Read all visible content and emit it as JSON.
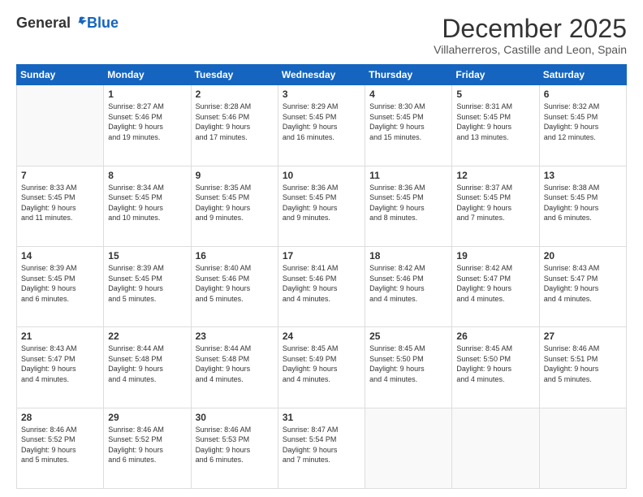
{
  "logo": {
    "general": "General",
    "blue": "Blue"
  },
  "header": {
    "month": "December 2025",
    "location": "Villaherreros, Castille and Leon, Spain"
  },
  "weekdays": [
    "Sunday",
    "Monday",
    "Tuesday",
    "Wednesday",
    "Thursday",
    "Friday",
    "Saturday"
  ],
  "weeks": [
    [
      {
        "day": "",
        "info": ""
      },
      {
        "day": "1",
        "info": "Sunrise: 8:27 AM\nSunset: 5:46 PM\nDaylight: 9 hours\nand 19 minutes."
      },
      {
        "day": "2",
        "info": "Sunrise: 8:28 AM\nSunset: 5:46 PM\nDaylight: 9 hours\nand 17 minutes."
      },
      {
        "day": "3",
        "info": "Sunrise: 8:29 AM\nSunset: 5:45 PM\nDaylight: 9 hours\nand 16 minutes."
      },
      {
        "day": "4",
        "info": "Sunrise: 8:30 AM\nSunset: 5:45 PM\nDaylight: 9 hours\nand 15 minutes."
      },
      {
        "day": "5",
        "info": "Sunrise: 8:31 AM\nSunset: 5:45 PM\nDaylight: 9 hours\nand 13 minutes."
      },
      {
        "day": "6",
        "info": "Sunrise: 8:32 AM\nSunset: 5:45 PM\nDaylight: 9 hours\nand 12 minutes."
      }
    ],
    [
      {
        "day": "7",
        "info": "Sunrise: 8:33 AM\nSunset: 5:45 PM\nDaylight: 9 hours\nand 11 minutes."
      },
      {
        "day": "8",
        "info": "Sunrise: 8:34 AM\nSunset: 5:45 PM\nDaylight: 9 hours\nand 10 minutes."
      },
      {
        "day": "9",
        "info": "Sunrise: 8:35 AM\nSunset: 5:45 PM\nDaylight: 9 hours\nand 9 minutes."
      },
      {
        "day": "10",
        "info": "Sunrise: 8:36 AM\nSunset: 5:45 PM\nDaylight: 9 hours\nand 9 minutes."
      },
      {
        "day": "11",
        "info": "Sunrise: 8:36 AM\nSunset: 5:45 PM\nDaylight: 9 hours\nand 8 minutes."
      },
      {
        "day": "12",
        "info": "Sunrise: 8:37 AM\nSunset: 5:45 PM\nDaylight: 9 hours\nand 7 minutes."
      },
      {
        "day": "13",
        "info": "Sunrise: 8:38 AM\nSunset: 5:45 PM\nDaylight: 9 hours\nand 6 minutes."
      }
    ],
    [
      {
        "day": "14",
        "info": "Sunrise: 8:39 AM\nSunset: 5:45 PM\nDaylight: 9 hours\nand 6 minutes."
      },
      {
        "day": "15",
        "info": "Sunrise: 8:39 AM\nSunset: 5:45 PM\nDaylight: 9 hours\nand 5 minutes."
      },
      {
        "day": "16",
        "info": "Sunrise: 8:40 AM\nSunset: 5:46 PM\nDaylight: 9 hours\nand 5 minutes."
      },
      {
        "day": "17",
        "info": "Sunrise: 8:41 AM\nSunset: 5:46 PM\nDaylight: 9 hours\nand 4 minutes."
      },
      {
        "day": "18",
        "info": "Sunrise: 8:42 AM\nSunset: 5:46 PM\nDaylight: 9 hours\nand 4 minutes."
      },
      {
        "day": "19",
        "info": "Sunrise: 8:42 AM\nSunset: 5:47 PM\nDaylight: 9 hours\nand 4 minutes."
      },
      {
        "day": "20",
        "info": "Sunrise: 8:43 AM\nSunset: 5:47 PM\nDaylight: 9 hours\nand 4 minutes."
      }
    ],
    [
      {
        "day": "21",
        "info": "Sunrise: 8:43 AM\nSunset: 5:47 PM\nDaylight: 9 hours\nand 4 minutes."
      },
      {
        "day": "22",
        "info": "Sunrise: 8:44 AM\nSunset: 5:48 PM\nDaylight: 9 hours\nand 4 minutes."
      },
      {
        "day": "23",
        "info": "Sunrise: 8:44 AM\nSunset: 5:48 PM\nDaylight: 9 hours\nand 4 minutes."
      },
      {
        "day": "24",
        "info": "Sunrise: 8:45 AM\nSunset: 5:49 PM\nDaylight: 9 hours\nand 4 minutes."
      },
      {
        "day": "25",
        "info": "Sunrise: 8:45 AM\nSunset: 5:50 PM\nDaylight: 9 hours\nand 4 minutes."
      },
      {
        "day": "26",
        "info": "Sunrise: 8:45 AM\nSunset: 5:50 PM\nDaylight: 9 hours\nand 4 minutes."
      },
      {
        "day": "27",
        "info": "Sunrise: 8:46 AM\nSunset: 5:51 PM\nDaylight: 9 hours\nand 5 minutes."
      }
    ],
    [
      {
        "day": "28",
        "info": "Sunrise: 8:46 AM\nSunset: 5:52 PM\nDaylight: 9 hours\nand 5 minutes."
      },
      {
        "day": "29",
        "info": "Sunrise: 8:46 AM\nSunset: 5:52 PM\nDaylight: 9 hours\nand 6 minutes."
      },
      {
        "day": "30",
        "info": "Sunrise: 8:46 AM\nSunset: 5:53 PM\nDaylight: 9 hours\nand 6 minutes."
      },
      {
        "day": "31",
        "info": "Sunrise: 8:47 AM\nSunset: 5:54 PM\nDaylight: 9 hours\nand 7 minutes."
      },
      {
        "day": "",
        "info": ""
      },
      {
        "day": "",
        "info": ""
      },
      {
        "day": "",
        "info": ""
      }
    ]
  ]
}
